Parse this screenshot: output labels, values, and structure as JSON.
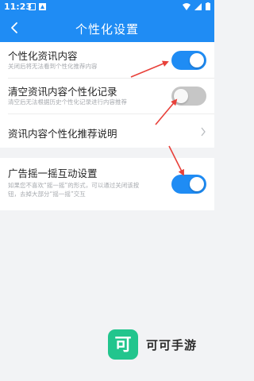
{
  "status_bar": {
    "time": "11:23"
  },
  "header": {
    "title": "个性化设置",
    "back_icon": "back-arrow-icon"
  },
  "settings": {
    "personalized_news": {
      "label": "个性化资讯内容",
      "description": "关闭后将无法看到个性化推荐内容",
      "enabled": true
    },
    "clear_records": {
      "label": "清空资讯内容个性化记录",
      "description": "清空后无法根据历史个性化记录进行内容推荐",
      "enabled": false
    },
    "explanation": {
      "label": "资讯内容个性化推荐说明"
    },
    "shake_ads": {
      "label": "广告摇一摇互动设置",
      "description_line1": "如果您不喜欢“摇一摇”的形式，可以通过关闭该按",
      "description_line2": "钮，去掉大部分“摇一摇”交互",
      "enabled": true
    }
  },
  "watermark": {
    "logo_glyph": "可",
    "text": "可可手游"
  },
  "colors": {
    "accent": "#1f8cf4",
    "annotation": "#e8413a",
    "toggle_off": "#c6c6c6",
    "watermark": "#22c58d"
  }
}
